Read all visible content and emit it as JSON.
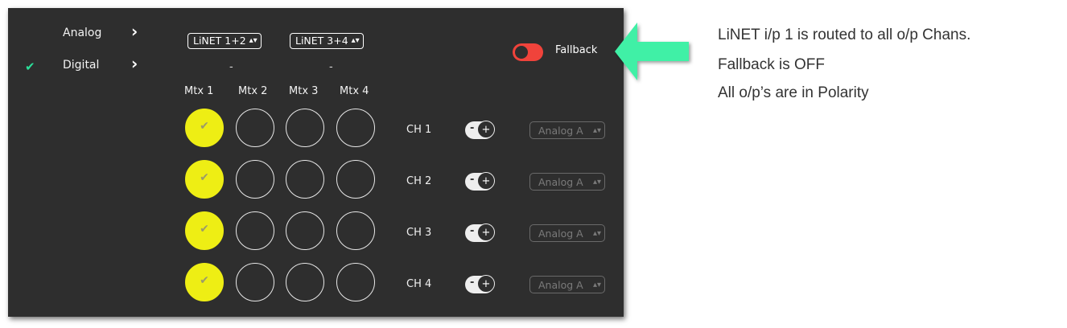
{
  "sidebar": {
    "items": [
      {
        "label": "Analog",
        "checked": false
      },
      {
        "label": "Digital",
        "checked": true
      }
    ]
  },
  "sources": [
    {
      "label": "LiNET 1+2",
      "value": "-"
    },
    {
      "label": "LiNET 3+4",
      "value": "-"
    }
  ],
  "fallback": {
    "label": "Fallback",
    "state": "OFF",
    "color": "#f0433b"
  },
  "matrix": {
    "columns": [
      "Mtx 1",
      "Mtx 2",
      "Mtx 3",
      "Mtx 4"
    ],
    "rows": [
      {
        "channel": "CH 1",
        "selected": 1,
        "polarity_minus": "-",
        "polarity_plus": "+",
        "output": "Analog A"
      },
      {
        "channel": "CH 2",
        "selected": 1,
        "polarity_minus": "-",
        "polarity_plus": "+",
        "output": "Analog A"
      },
      {
        "channel": "CH 3",
        "selected": 1,
        "polarity_minus": "-",
        "polarity_plus": "+",
        "output": "Analog A"
      },
      {
        "channel": "CH 4",
        "selected": 1,
        "polarity_minus": "-",
        "polarity_plus": "+",
        "output": "Analog A"
      }
    ],
    "selected_color": "#eeee14"
  },
  "annotation": {
    "arrow_color": "#3ff0a6",
    "lines": [
      "LiNET i/p 1 is routed to all o/p Chans.",
      "Fallback is OFF",
      "All o/p’s are in Polarity"
    ]
  }
}
